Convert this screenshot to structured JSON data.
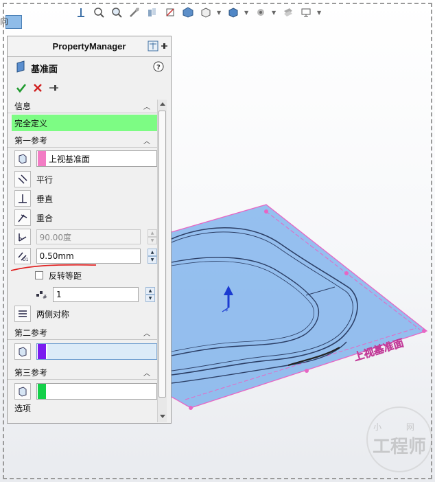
{
  "window": {
    "corner_text": "向"
  },
  "toolbar": {
    "icons": [
      "view-orientation-icon",
      "zoom-to-fit-icon",
      "zoom-area-icon",
      "previous-view-icon",
      "section-view-icon",
      "view-selector-icon",
      "display-style-icon",
      "hide-show-icon",
      "edit-appearance-icon",
      "apply-scene-icon",
      "view-settings-icon",
      "display-icon"
    ]
  },
  "property_manager": {
    "title": "PropertyManager",
    "feature_name": "基准面",
    "sections": {
      "info": {
        "title": "信息",
        "status": "完全定义",
        "status_color": "#7dfc84"
      },
      "first_reference": {
        "title": "第一参考",
        "selection": "上视基准面",
        "chip_color": "#f27cc4",
        "options": {
          "parallel": "平行",
          "perpendicular": "垂直",
          "coincident": "重合"
        },
        "angle_value": "90.00度",
        "offset_value": "0.50mm",
        "flip_offset_label": "反转等距",
        "flip_offset_checked": false,
        "count_value": "1",
        "mid_plane_label": "两侧对称"
      },
      "second_reference": {
        "title": "第二参考",
        "chip_color": "#7a1cf0"
      },
      "third_reference": {
        "title": "第三参考",
        "chip_color": "#14d04a"
      },
      "options_cut": {
        "title": "选项"
      }
    }
  },
  "viewport": {
    "plane_label": "上视基准面",
    "plane_color": "#6fa9ea",
    "plane_edge_color": "#e766c4"
  },
  "watermark": {
    "top": "小 网",
    "main": "工程师"
  }
}
